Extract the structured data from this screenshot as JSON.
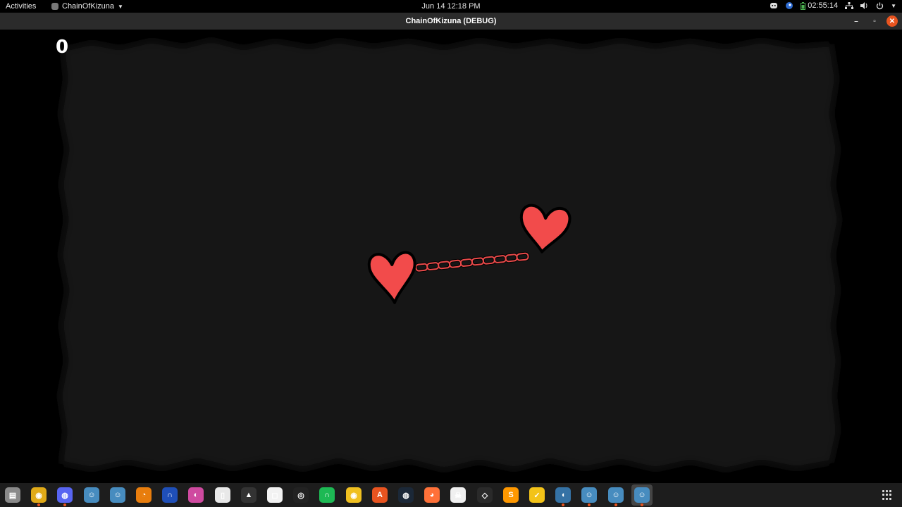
{
  "topbar": {
    "activities": "Activities",
    "app_menu_label": "ChainOfKizuna",
    "clock": "Jun 14  12:18 PM",
    "tray": {
      "timer": "02:55:14",
      "icons": [
        "discord-icon",
        "steam-tray-icon",
        "battery-icon",
        "network-icon",
        "volume-icon",
        "power-icon"
      ]
    }
  },
  "window": {
    "title": "ChainOfKizuna (DEBUG)",
    "controls": {
      "minimize": "–",
      "restore": "▫",
      "close": "✕"
    }
  },
  "game": {
    "score": "0",
    "colors": {
      "arena": "#161616",
      "heart": "#f24b4b",
      "chain": "#e94a4a",
      "outline": "#000000"
    }
  },
  "dock": {
    "apps": [
      {
        "name": "files",
        "label": "▤",
        "color": "#8a8a8a"
      },
      {
        "name": "chrome",
        "label": "◉",
        "color": "#e0aa18",
        "running": true
      },
      {
        "name": "discord",
        "label": "◍",
        "color": "#5865f2",
        "running": true
      },
      {
        "name": "godot",
        "label": "☺",
        "color": "#478cbf"
      },
      {
        "name": "godot-2",
        "label": "☺",
        "color": "#478cbf"
      },
      {
        "name": "blender",
        "label": "◔",
        "color": "#e87d0d"
      },
      {
        "name": "headphones-app",
        "label": "∩",
        "color": "#1f4fb8"
      },
      {
        "name": "krita",
        "label": "◐",
        "color": "#cf4aa0"
      },
      {
        "name": "twitch",
        "label": "▯",
        "color": "#e8e8e8"
      },
      {
        "name": "inkscape",
        "label": "▲",
        "color": "#333333"
      },
      {
        "name": "unknown-app",
        "label": "◻",
        "color": "#f2f2f2"
      },
      {
        "name": "obs",
        "label": "◎",
        "color": "#222222"
      },
      {
        "name": "spotify-style",
        "label": "∩",
        "color": "#1db954"
      },
      {
        "name": "rhythmbox",
        "label": "◉",
        "color": "#f0c020"
      },
      {
        "name": "software-center",
        "label": "A",
        "color": "#e95420"
      },
      {
        "name": "steam",
        "label": "◍",
        "color": "#1b2838"
      },
      {
        "name": "firefox-like",
        "label": "◕",
        "color": "#ff7139"
      },
      {
        "name": "pirate-game",
        "label": "☠",
        "color": "#f0f0f0"
      },
      {
        "name": "unity",
        "label": "◇",
        "color": "#2a2a2a"
      },
      {
        "name": "sublime",
        "label": "S",
        "color": "#ff9800"
      },
      {
        "name": "vectr",
        "label": "✓",
        "color": "#f3c318"
      },
      {
        "name": "python",
        "label": "◖",
        "color": "#3572a5",
        "running": true
      },
      {
        "name": "godot-3",
        "label": "☺",
        "color": "#478cbf",
        "running": true
      },
      {
        "name": "godot-4",
        "label": "☺",
        "color": "#478cbf",
        "running": true
      },
      {
        "name": "godot-debug",
        "label": "☺",
        "color": "#478cbf",
        "running": true,
        "active": true
      }
    ]
  }
}
